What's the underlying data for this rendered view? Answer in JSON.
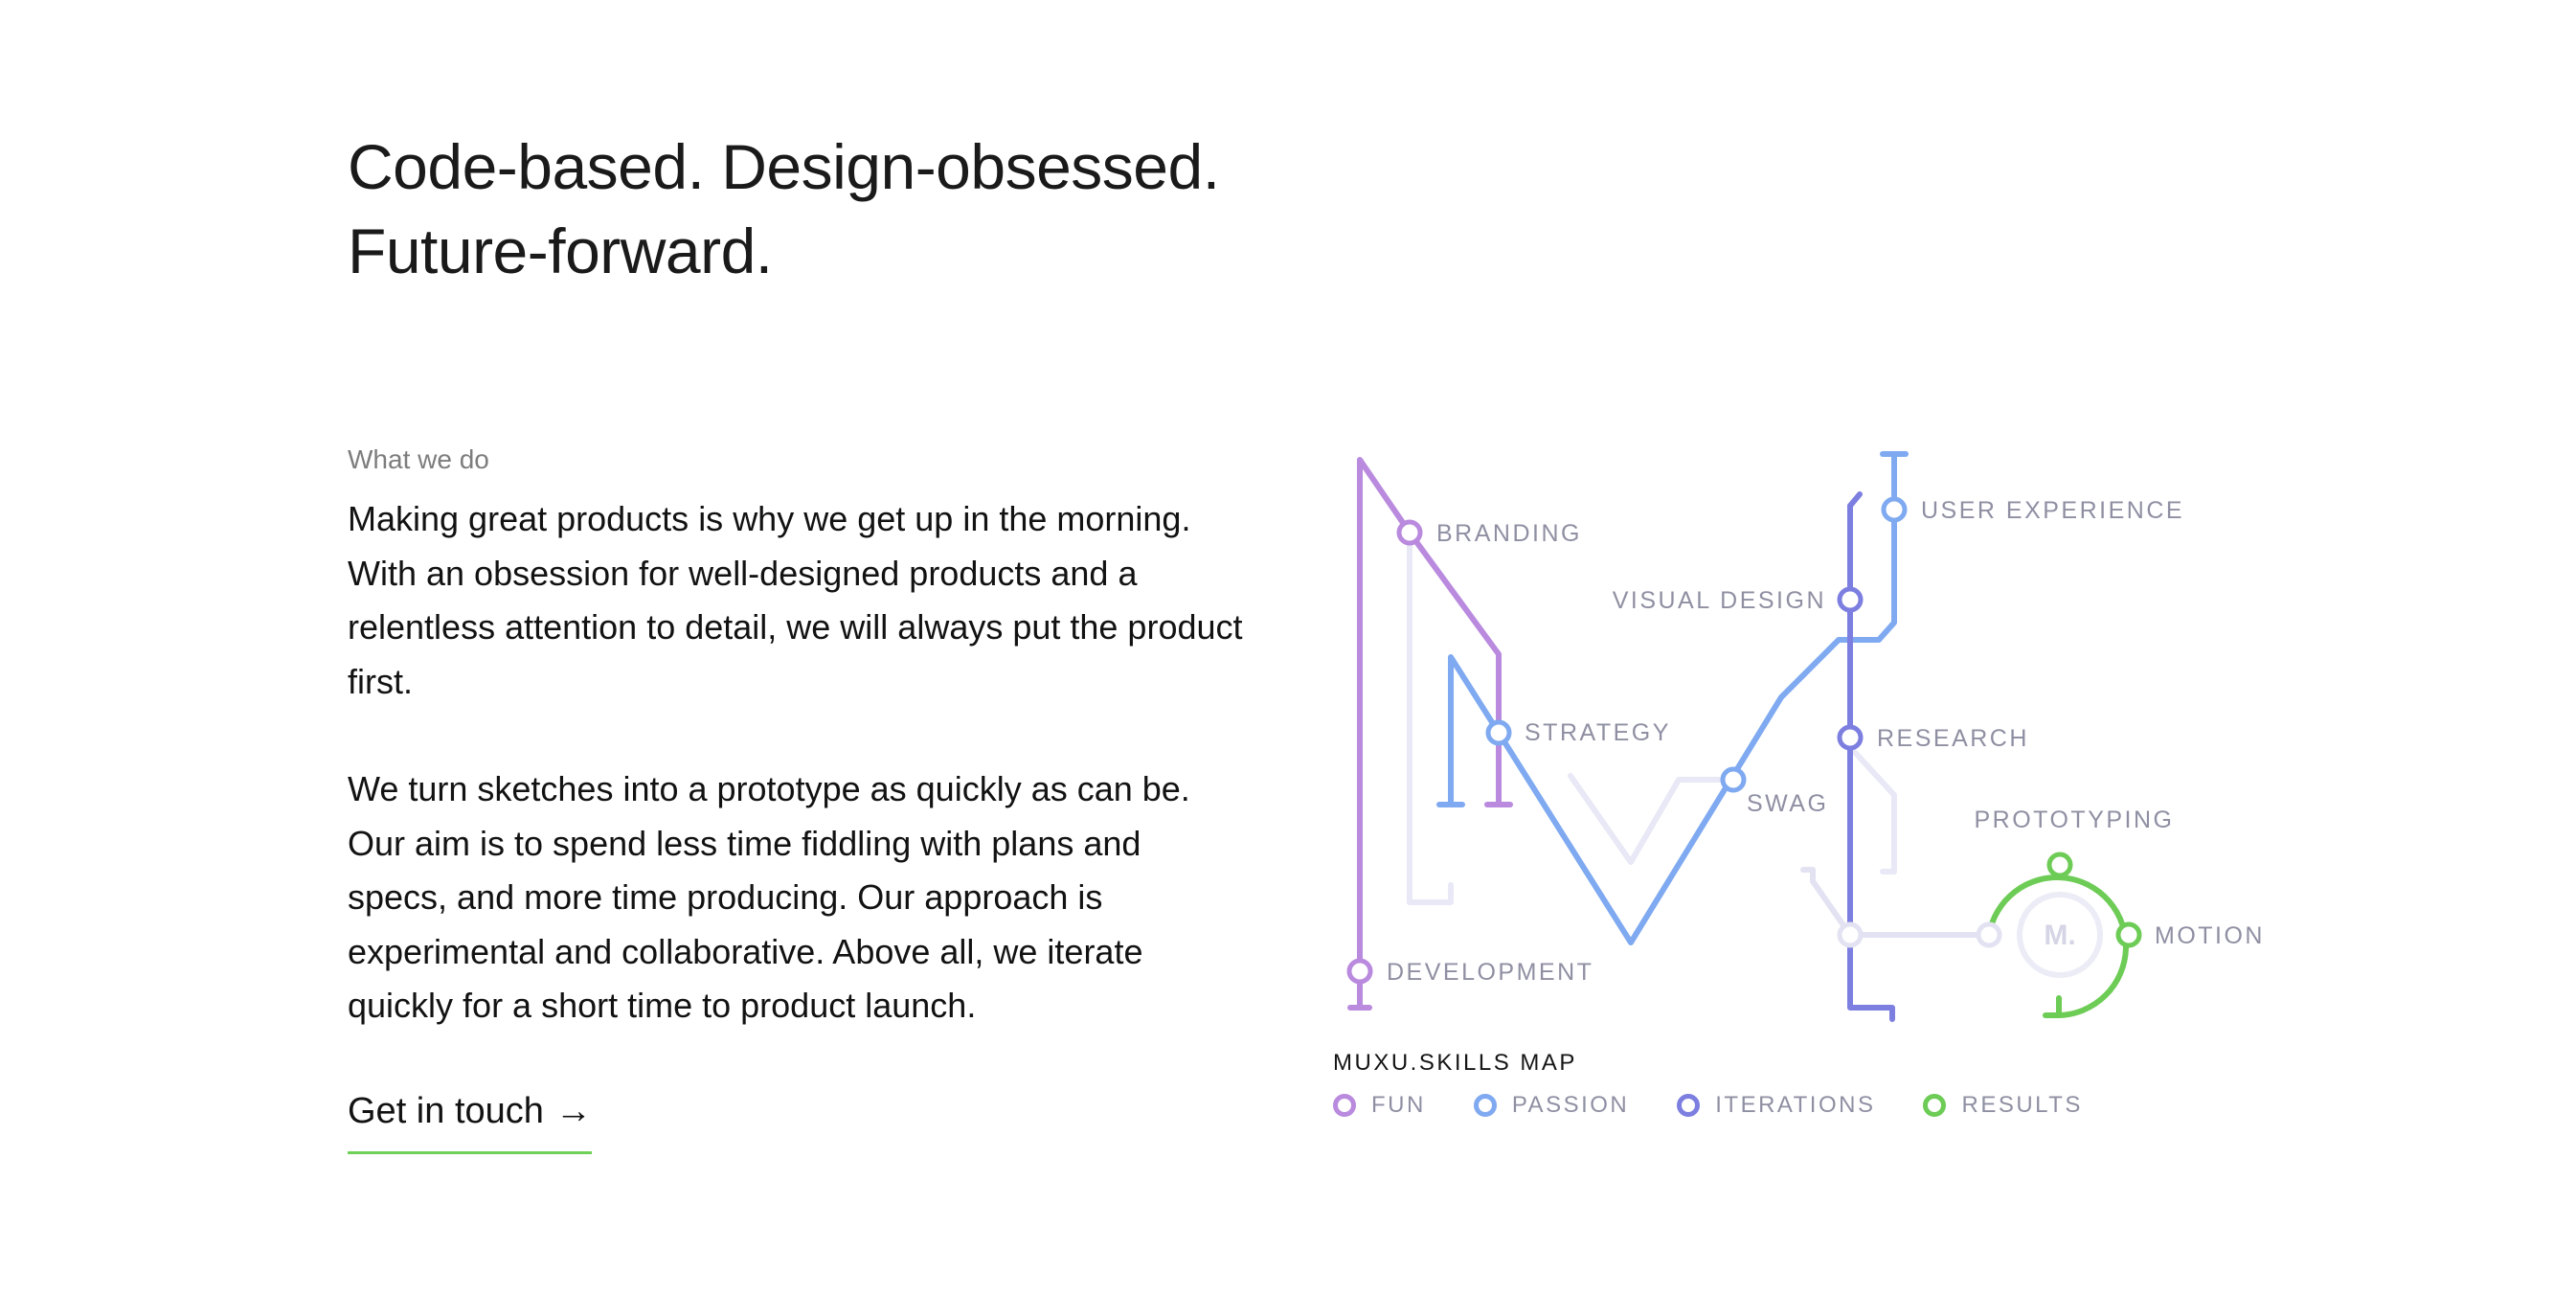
{
  "headline": {
    "line1": "Code-based. Design-obsessed.",
    "line2": "Future-forward."
  },
  "what_we_do": {
    "eyebrow": "What we do",
    "paragraph1": "Making great products is why we get up in the morning. With an obsession for well-designed products and a relentless attention to detail, we will always put the product first.",
    "paragraph2": "We turn sketches into a prototype as quickly as can be. Our aim is to spend less time fiddling with plans and specs, and more time producing. Our approach is experimental and collaborative. Above all, we iterate quickly for a short time to product launch."
  },
  "cta": {
    "label": "Get in touch",
    "arrow": "→"
  },
  "skills_map": {
    "title": "MUXU.SKILLS MAP",
    "logo_text": "M.",
    "stations": {
      "branding": "BRANDING",
      "strategy": "STRATEGY",
      "development": "DEVELOPMENT",
      "visual_design": "VISUAL DESIGN",
      "swag": "SWAG",
      "user_experience": "USER EXPERIENCE",
      "research": "RESEARCH",
      "prototyping": "PROTOTYPING",
      "motion": "MOTION"
    },
    "legend": [
      {
        "label": "FUN",
        "color": "#b98ade"
      },
      {
        "label": "PASSION",
        "color": "#7fa9f0"
      },
      {
        "label": "ITERATIONS",
        "color": "#7d7fe0"
      },
      {
        "label": "RESULTS",
        "color": "#6dcc55"
      }
    ],
    "colors": {
      "fun": "#b98ade",
      "passion": "#7fa9f0",
      "iterations": "#7d7fe0",
      "results": "#6dcc55",
      "muted": "#e6e6f5"
    }
  }
}
